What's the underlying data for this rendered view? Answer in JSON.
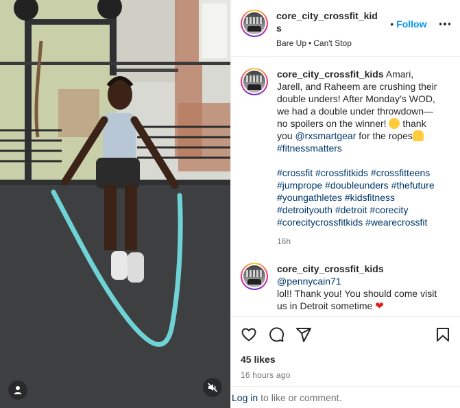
{
  "post": {
    "username": "core_city_crossfit_kids",
    "username_wrap": [
      "core_city_crossfit_kid",
      "s"
    ],
    "follow_label": "Follow",
    "header_dot": "•",
    "audio": {
      "artist": "Bare Up",
      "sep": "•",
      "track": "Can't Stop"
    },
    "more_icon": "more-horizontal-icon"
  },
  "caption": {
    "username": "core_city_crossfit_kids",
    "text_1": "Amari, Jarell, and Raheem are crushing their double unders! After Monday’s WOD, we had a double under throwdown—no spoilers on the winner!",
    "text_2": "thank you",
    "mention": "@rxsmartgear",
    "text_3": "for the ropes",
    "hashtag_1": "#fitnessmatters",
    "hashtags": "#crossfit #crossfitkids #crossfitteens #jumprope #doubleunders #thefuture #youngathletes #kidsfitness #detroityouth #detroit #corecity #corecitycrossfitkids #wearecrossfit",
    "time": "16h"
  },
  "reply": {
    "username": "core_city_crossfit_kids",
    "mention": "@pennycain71",
    "text": "lol!! Thank you! You should come visit us in Detroit sometime"
  },
  "actions": {
    "icons": [
      "heart-icon",
      "comment-icon",
      "share-icon",
      "bookmark-icon"
    ],
    "likes": "45 likes",
    "ago": "16 hours ago"
  },
  "login": {
    "link": "Log in",
    "text": "to like or comment."
  },
  "colors": {
    "accent": "#0095f6",
    "link": "#00376b",
    "secondary": "#737373",
    "rope": "#6fd3d6"
  }
}
